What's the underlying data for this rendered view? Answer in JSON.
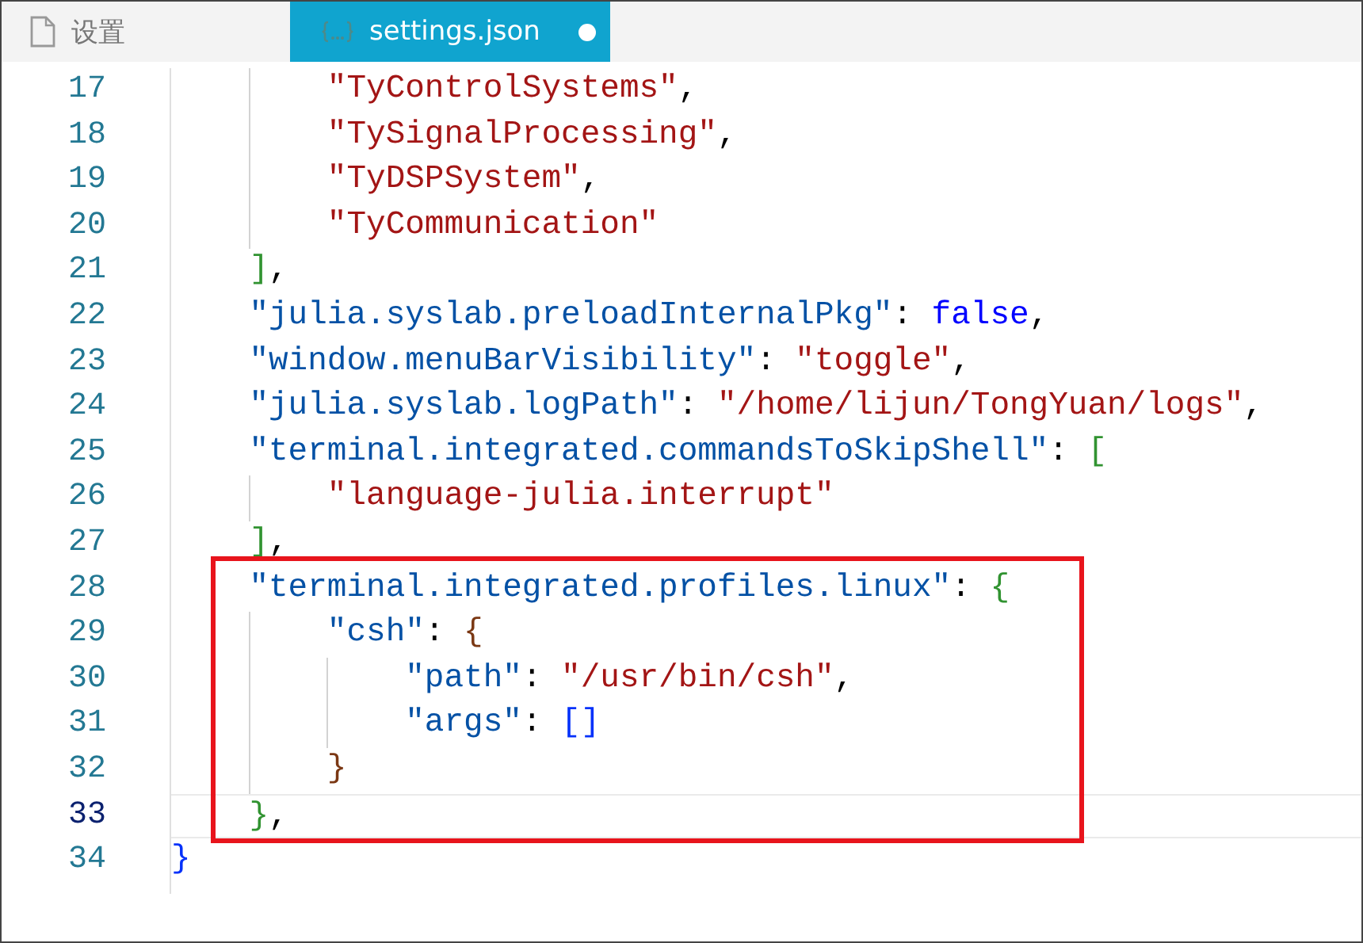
{
  "tabs": [
    {
      "label": "设置",
      "kind": "settings",
      "selected": false,
      "modified": false
    },
    {
      "label": "settings.json",
      "kind": "json",
      "selected": true,
      "modified": true
    }
  ],
  "editor": {
    "lines": [
      {
        "number": "17",
        "current": false,
        "tokens": [
          {
            "kind": "string",
            "text": "        \"TyControlSystems\""
          },
          {
            "kind": "punct",
            "text": ","
          }
        ]
      },
      {
        "number": "18",
        "current": false,
        "tokens": [
          {
            "kind": "string",
            "text": "        \"TySignalProcessing\""
          },
          {
            "kind": "punct",
            "text": ","
          }
        ]
      },
      {
        "number": "19",
        "current": false,
        "tokens": [
          {
            "kind": "string",
            "text": "        \"TyDSPSystem\""
          },
          {
            "kind": "punct",
            "text": ","
          }
        ]
      },
      {
        "number": "20",
        "current": false,
        "tokens": [
          {
            "kind": "string",
            "text": "        \"TyCommunication\""
          }
        ]
      },
      {
        "number": "21",
        "current": false,
        "tokens": [
          {
            "kind": "bracket",
            "text": "    ]",
            "color": "#319331"
          },
          {
            "kind": "punct",
            "text": ","
          }
        ]
      },
      {
        "number": "22",
        "current": false,
        "tokens": [
          {
            "kind": "key",
            "text": "    \"julia.syslab.preloadInternalPkg\""
          },
          {
            "kind": "punct",
            "text": ": "
          },
          {
            "kind": "keyword",
            "text": "false"
          },
          {
            "kind": "punct",
            "text": ","
          }
        ]
      },
      {
        "number": "23",
        "current": false,
        "tokens": [
          {
            "kind": "key",
            "text": "    \"window.menuBarVisibility\""
          },
          {
            "kind": "punct",
            "text": ": "
          },
          {
            "kind": "string",
            "text": "\"toggle\""
          },
          {
            "kind": "punct",
            "text": ","
          }
        ]
      },
      {
        "number": "24",
        "current": false,
        "tokens": [
          {
            "kind": "key",
            "text": "    \"julia.syslab.logPath\""
          },
          {
            "kind": "punct",
            "text": ": "
          },
          {
            "kind": "string",
            "text": "\"/home/lijun/TongYuan/logs\""
          },
          {
            "kind": "punct",
            "text": ","
          }
        ]
      },
      {
        "number": "25",
        "current": false,
        "tokens": [
          {
            "kind": "key",
            "text": "    \"terminal.integrated.commandsToSkipShell\""
          },
          {
            "kind": "punct",
            "text": ": "
          },
          {
            "kind": "bracket",
            "text": "[",
            "color": "#319331"
          }
        ]
      },
      {
        "number": "26",
        "current": false,
        "tokens": [
          {
            "kind": "string",
            "text": "        \"language-julia.interrupt\""
          }
        ]
      },
      {
        "number": "27",
        "current": false,
        "tokens": [
          {
            "kind": "bracket",
            "text": "    ]",
            "color": "#319331"
          },
          {
            "kind": "punct",
            "text": ","
          }
        ]
      },
      {
        "number": "28",
        "current": false,
        "tokens": [
          {
            "kind": "key",
            "text": "    \"terminal.integrated.profiles.linux\""
          },
          {
            "kind": "punct",
            "text": ": "
          },
          {
            "kind": "bracket",
            "text": "{",
            "color": "#319331"
          }
        ]
      },
      {
        "number": "29",
        "current": false,
        "tokens": [
          {
            "kind": "key",
            "text": "        \"csh\""
          },
          {
            "kind": "punct",
            "text": ": "
          },
          {
            "kind": "bracket",
            "text": "{",
            "color": "#7b3814"
          }
        ]
      },
      {
        "number": "30",
        "current": false,
        "tokens": [
          {
            "kind": "key",
            "text": "            \"path\""
          },
          {
            "kind": "punct",
            "text": ": "
          },
          {
            "kind": "string",
            "text": "\"/usr/bin/csh\""
          },
          {
            "kind": "punct",
            "text": ","
          }
        ]
      },
      {
        "number": "31",
        "current": false,
        "tokens": [
          {
            "kind": "key",
            "text": "            \"args\""
          },
          {
            "kind": "punct",
            "text": ": "
          },
          {
            "kind": "bracket",
            "text": "[]",
            "color": "#0431fa"
          }
        ]
      },
      {
        "number": "32",
        "current": false,
        "tokens": [
          {
            "kind": "bracket",
            "text": "        }",
            "color": "#7b3814"
          }
        ]
      },
      {
        "number": "33",
        "current": true,
        "tokens": [
          {
            "kind": "bracket",
            "text": "    }",
            "color": "#319331"
          },
          {
            "kind": "punct",
            "text": ","
          }
        ]
      },
      {
        "number": "34",
        "current": false,
        "tokens": [
          {
            "kind": "bracket",
            "text": "}",
            "color": "#0431fa"
          }
        ]
      }
    ]
  }
}
